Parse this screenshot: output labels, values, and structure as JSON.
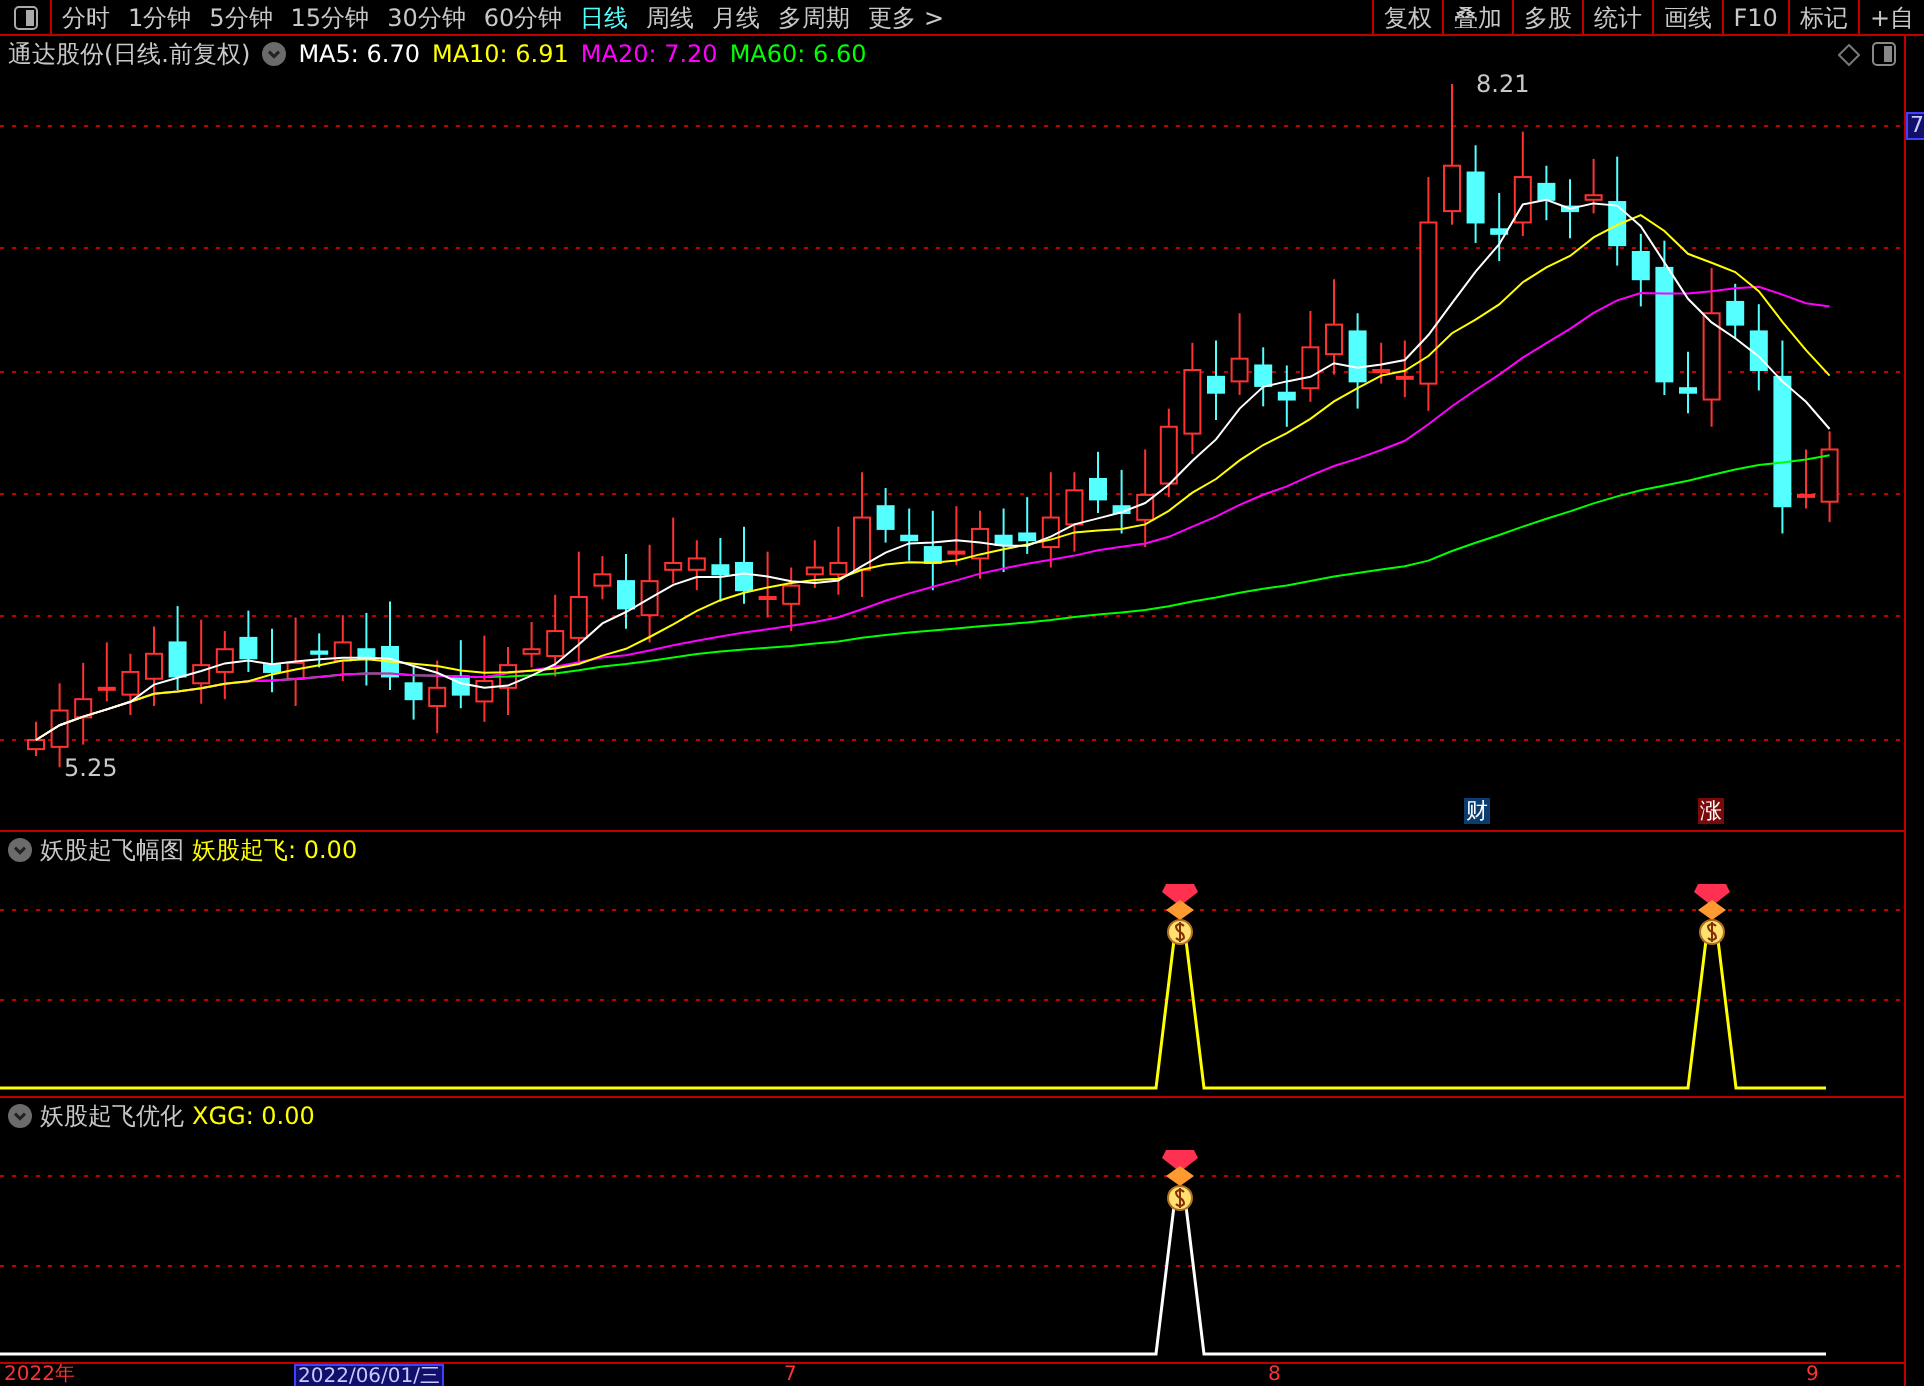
{
  "toolbar": {
    "periods": [
      {
        "label": "分时",
        "selected": false
      },
      {
        "label": "1分钟",
        "selected": false
      },
      {
        "label": "5分钟",
        "selected": false
      },
      {
        "label": "15分钟",
        "selected": false
      },
      {
        "label": "30分钟",
        "selected": false
      },
      {
        "label": "60分钟",
        "selected": false
      },
      {
        "label": "日线",
        "selected": true
      },
      {
        "label": "周线",
        "selected": false
      },
      {
        "label": "月线",
        "selected": false
      },
      {
        "label": "多周期",
        "selected": false
      },
      {
        "label": "更多 >",
        "selected": false
      }
    ],
    "actions": [
      "复权",
      "叠加",
      "多股",
      "统计",
      "画线",
      "F10",
      "标记",
      "+自"
    ]
  },
  "main_chart": {
    "title": "通达股份(日线.前复权)",
    "ma": [
      {
        "label": "MA5: 6.70",
        "color": "#ffffff"
      },
      {
        "label": "MA10: 6.91",
        "color": "#ffff00"
      },
      {
        "label": "MA20: 7.20",
        "color": "#ff00ff"
      },
      {
        "label": "MA60: 6.60",
        "color": "#00ff00"
      }
    ],
    "high_label": "8.21",
    "low_label": "5.25",
    "axis_label": "7",
    "markers": [
      {
        "text": "财",
        "color": "#0a3d6e"
      },
      {
        "text": "涨",
        "color": "#7a0a0a"
      }
    ]
  },
  "indicator_1": {
    "title": "妖股起飞幅图",
    "value": "妖股起飞: 0.00"
  },
  "indicator_2": {
    "title": "妖股起飞优化",
    "value": "XGG: 0.00"
  },
  "date_axis": [
    {
      "label": "2022年",
      "selected": false
    },
    {
      "label": "2022/06/01/三",
      "selected": true
    },
    {
      "label": "7",
      "selected": false
    },
    {
      "label": "8",
      "selected": false
    },
    {
      "label": "9",
      "selected": false
    }
  ]
}
